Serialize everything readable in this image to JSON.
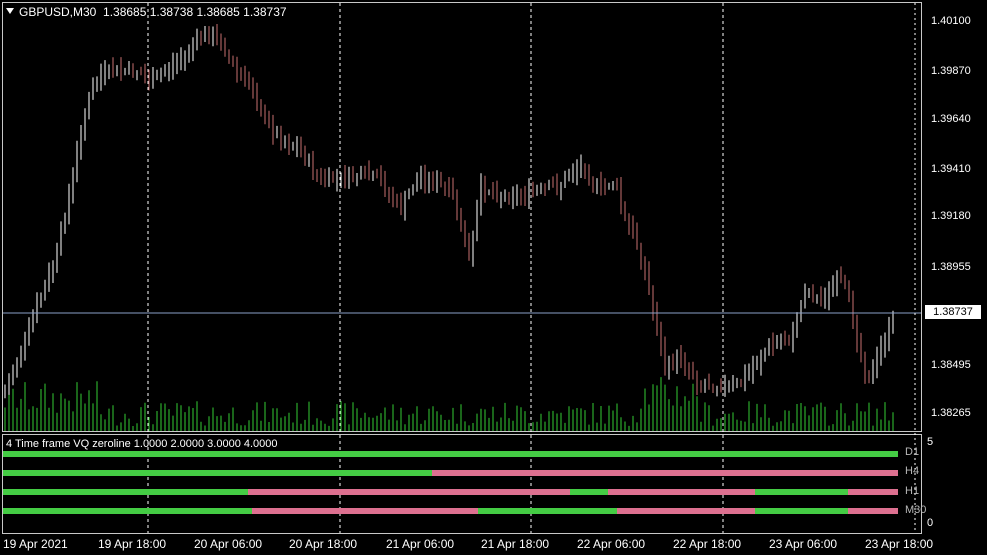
{
  "chart_header": {
    "symbol_tf": "GBPUSD,M30",
    "ohlc": "1.38685 1.38738 1.38685 1.38737"
  },
  "price_axis": {
    "labels": [
      "1.40100",
      "1.39870",
      "1.39640",
      "1.39410",
      "1.39180",
      "1.38955",
      "1.38495",
      "1.38265"
    ],
    "current_price": "1.38737"
  },
  "time_axis": {
    "labels": [
      "19 Apr 2021",
      "19 Apr 18:00",
      "20 Apr 06:00",
      "20 Apr 18:00",
      "21 Apr 06:00",
      "21 Apr 18:00",
      "22 Apr 06:00",
      "22 Apr 18:00",
      "23 Apr 06:00",
      "23 Apr 18:00"
    ]
  },
  "indicator": {
    "title": "4 Time frame VQ zeroline 1.0000 2.0000 3.0000 4.0000",
    "scale_max": "5",
    "scale_min": "0",
    "timeframes": [
      "D1",
      "H4",
      "H1",
      "M30"
    ]
  },
  "colors": {
    "background": "#000000",
    "up_candle": "#ffffff",
    "down_candle": "#c87070",
    "volume": "#33cc33",
    "bull": "#44cc44",
    "bear": "#dd7090",
    "grid": "#ffffff",
    "price_line": "#8aa0c8"
  }
}
